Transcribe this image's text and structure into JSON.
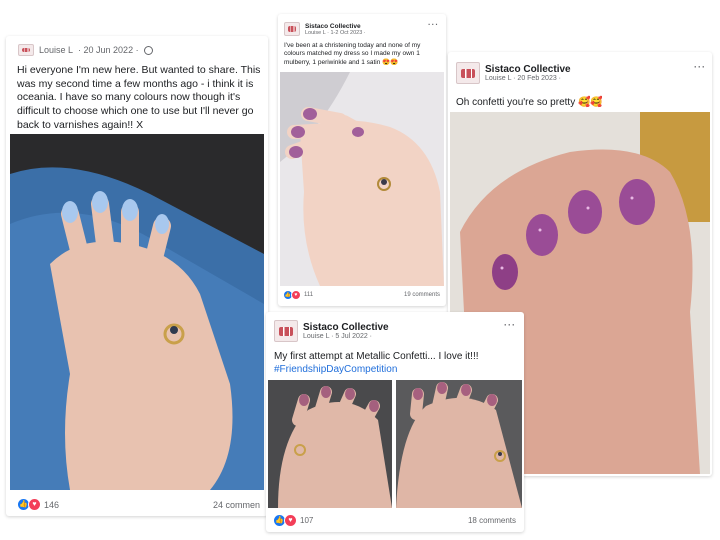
{
  "post1": {
    "author": "Louise L",
    "date": "· 20 Jun 2022 ·",
    "text": "Hi everyone I'm new here. But wanted to share. This was my second time a few months ago - i think it is oceania. I have so many colours now though it's difficult to choose which one to use but I'll never go back to varnishes again!! X",
    "reaction_count": "146",
    "comments": "24 commen"
  },
  "post2": {
    "page_name": "Sistaco Collective",
    "author_line": "Louise L · 1-2 Oct 2023 ·",
    "text": "I've been at a christening today and none of my colours matched my dress so I made my own 1 mulberry, 1 periwinkle and 1 satin 😍😍",
    "reaction_count": "111",
    "comments": "19 comments"
  },
  "post3": {
    "page_name": "Sistaco Collective",
    "author_line": "Louise L · 20 Feb 2023 ·",
    "text": "Oh confetti you're so pretty 🥰🥰"
  },
  "post4": {
    "page_name": "Sistaco Collective",
    "author_line": "Louise L · 5 Jul 2022 ·",
    "text": "My first attempt at Metallic Confetti... I love it!!!",
    "hashtag": "#FriendshipDayCompetition",
    "reaction_count": "107",
    "comments": "18 comments"
  },
  "icons": [
    "more-options-icon",
    "globe-icon",
    "like-reaction-icon",
    "love-reaction-icon",
    "page-logo-icon"
  ],
  "colors": {
    "link_blue": "#216fdb",
    "like_blue": "#1877f2",
    "love_red": "#f33e58",
    "meta_grey": "#65676b"
  }
}
